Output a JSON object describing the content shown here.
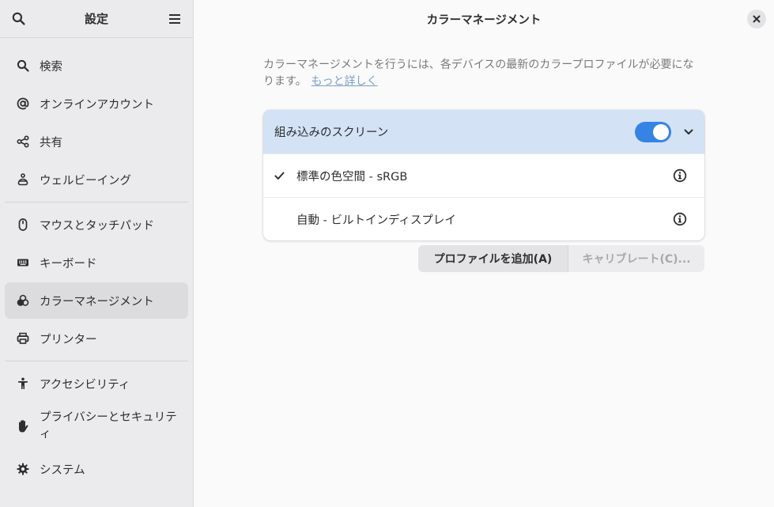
{
  "sidebar": {
    "title": "設定",
    "items": [
      {
        "label": "検索",
        "icon": "search-icon"
      },
      {
        "label": "オンラインアカウント",
        "icon": "at-icon"
      },
      {
        "label": "共有",
        "icon": "share-icon"
      },
      {
        "label": "ウェルビーイング",
        "icon": "wellbeing-icon"
      },
      {
        "label": "マウスとタッチパッド",
        "icon": "mouse-icon"
      },
      {
        "label": "キーボード",
        "icon": "keyboard-icon"
      },
      {
        "label": "カラーマネージメント",
        "icon": "color-icon"
      },
      {
        "label": "プリンター",
        "icon": "printer-icon"
      },
      {
        "label": "アクセシビリティ",
        "icon": "accessibility-icon"
      },
      {
        "label": "プライバシーとセキュリティ",
        "icon": "hand-icon"
      },
      {
        "label": "システム",
        "icon": "gear-icon"
      }
    ]
  },
  "main": {
    "title": "カラーマネージメント",
    "intro": "カラーマネージメントを行うには、各デバイスの最新のカラープロファイルが必要になります。",
    "learn_more": "もっと詳しく",
    "device": {
      "name": "組み込みのスクリーン",
      "enabled": true,
      "profiles": [
        {
          "label": "標準の色空間 - sRGB",
          "selected": true
        },
        {
          "label": "自動 - ビルトインディスプレイ",
          "selected": false
        }
      ]
    },
    "buttons": {
      "add_profile": "プロファイルを追加(A)",
      "calibrate": "キャリブレート(C)..."
    }
  },
  "colors": {
    "accent": "#3584e4",
    "selected_header": "#d3e2f5",
    "link": "#7b9ec9"
  }
}
